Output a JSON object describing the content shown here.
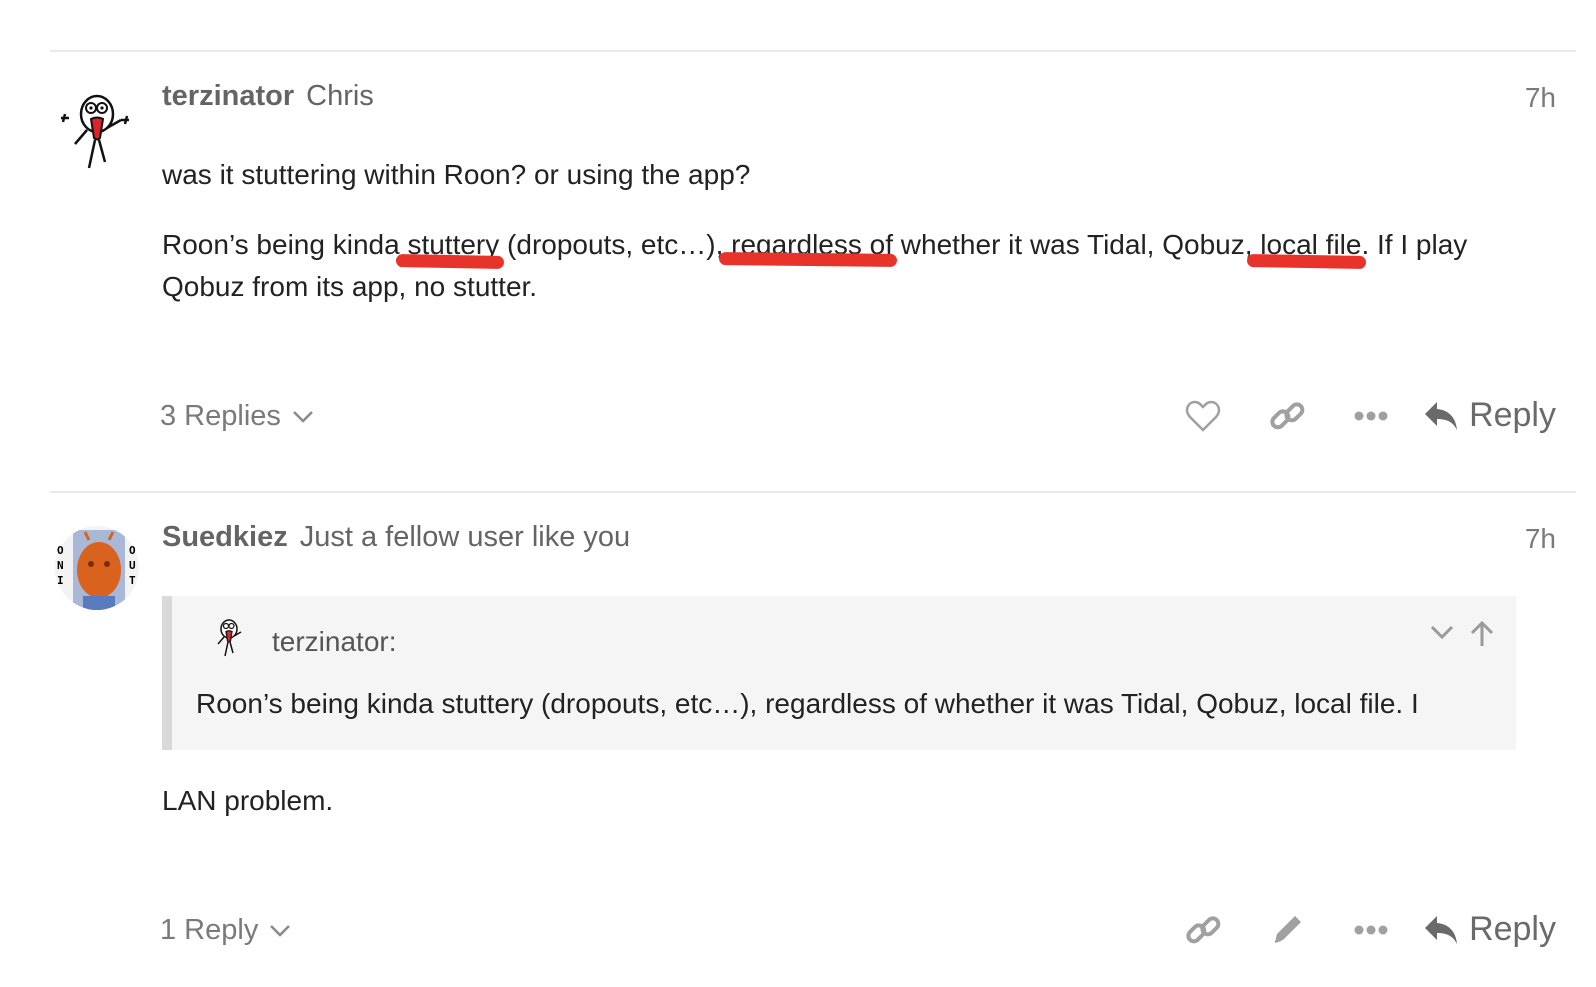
{
  "posts": [
    {
      "username": "terzinator",
      "full_name": "Chris",
      "age": "7h",
      "body": {
        "p1": "was it stuttering within Roon? or using the app?",
        "p2_a": "Roon’s being kinda",
        "p2_b": " stuttery",
        "p2_c": " (dropouts, etc…),",
        "p2_d": " regardless of",
        "p2_e": " whether it was Tidal, Qobuz,",
        "p2_f": " local file",
        "p2_g": ". If I play Qobuz from its app, no stutter."
      },
      "replies_label": "3 Replies",
      "reply_label": "Reply"
    },
    {
      "username": "Suedkiez",
      "full_name": "Just a fellow user like you",
      "age": "7h",
      "quote": {
        "author": "terzinator:",
        "text": "Roon’s being kinda stuttery (dropouts, etc…), regardless of whether it was Tidal, Qobuz, local file. I"
      },
      "body": "LAN problem.",
      "replies_label": "1 Reply",
      "reply_label": "Reply",
      "avatar_text": {
        "left": "ONI",
        "right": "OUT"
      }
    }
  ],
  "icons": [
    "like-icon",
    "link-icon",
    "more-icon",
    "reply-icon",
    "edit-icon",
    "chevron-down-icon",
    "arrow-up-icon"
  ],
  "colors": {
    "highlight": "#e8332a",
    "muted": "#7a7a7a",
    "quote_bg": "#f5f5f5"
  }
}
